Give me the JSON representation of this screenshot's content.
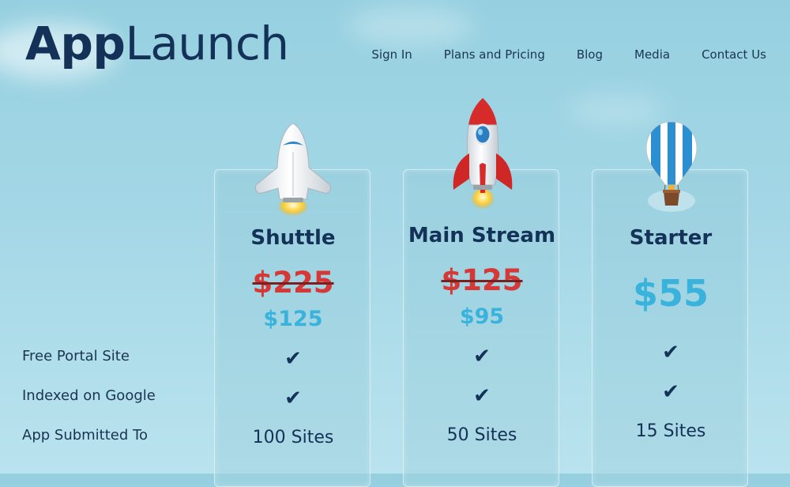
{
  "brand": {
    "name_bold": "App",
    "name_light": "Launch"
  },
  "nav": {
    "items": [
      "Sign In",
      "Plans and Pricing",
      "Blog",
      "Media",
      "Contact Us"
    ]
  },
  "features": {
    "labels": [
      "Free Portal Site",
      "Indexed on Google",
      "App Submitted To"
    ]
  },
  "plans": [
    {
      "name": "Shuttle",
      "icon": "space-shuttle-icon",
      "old_price": "$225",
      "price": "$125",
      "checks": [
        "✔",
        "✔"
      ],
      "sites": "100 Sites"
    },
    {
      "name": "Main Stream",
      "icon": "rocket-icon",
      "old_price": "$125",
      "price": "$95",
      "checks": [
        "✔",
        "✔"
      ],
      "sites": "50 Sites"
    },
    {
      "name": "Starter",
      "icon": "hot-air-balloon-icon",
      "price": "$55",
      "checks": [
        "✔",
        "✔"
      ],
      "sites": "15 Sites"
    }
  ],
  "colors": {
    "navy": "#143257",
    "old_price_red": "#d63737",
    "price_blue": "#3ab3dc",
    "background": "#a4d7e6"
  }
}
